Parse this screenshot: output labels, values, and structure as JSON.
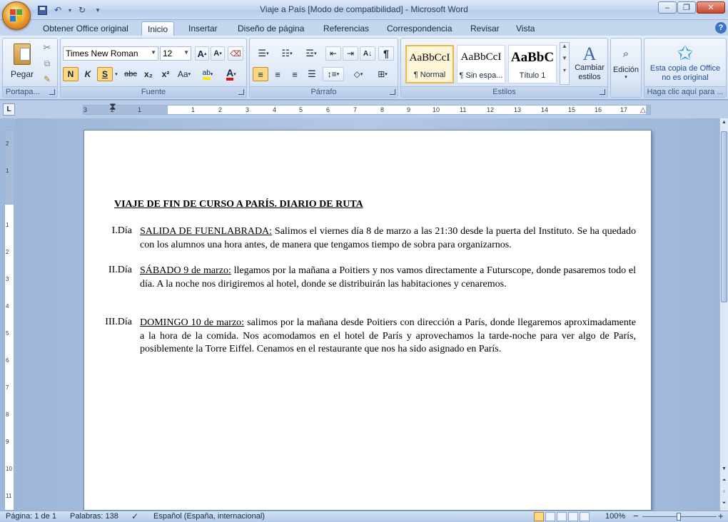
{
  "window": {
    "title": "Viaje a País [Modo de compatibilidad] - Microsoft Word",
    "minimize": "‒",
    "maximize": "❐",
    "close": "✕"
  },
  "tabs": [
    {
      "label": "Obtener Office original"
    },
    {
      "label": "Inicio"
    },
    {
      "label": "Insertar"
    },
    {
      "label": "Diseño de página"
    },
    {
      "label": "Referencias"
    },
    {
      "label": "Correspondencia"
    },
    {
      "label": "Revisar"
    },
    {
      "label": "Vista"
    }
  ],
  "ribbon": {
    "clipboard": {
      "label": "Portapa...",
      "paste": "Pegar"
    },
    "font": {
      "label": "Fuente",
      "font_name": "Times New Roman",
      "font_size": "12",
      "grow": "A",
      "shrink": "A",
      "bold": "N",
      "italic": "K",
      "underline": "S",
      "strike": "abc",
      "subscript": "x₂",
      "superscript": "x²",
      "case": "Aa",
      "highlight": "ab",
      "color": "A"
    },
    "paragraph": {
      "label": "Párrafo",
      "pilcrow": "¶",
      "sort": "A↓"
    },
    "styles": {
      "label": "Estilos",
      "items": [
        {
          "sample": "AaBbCcI",
          "name": "¶ Normal"
        },
        {
          "sample": "AaBbCcI",
          "name": "¶ Sin espa..."
        },
        {
          "sample": "AaBbC",
          "name": "Título 1"
        }
      ],
      "change_styles": "Cambiar estilos"
    },
    "editing": {
      "label": "Edición"
    },
    "office": {
      "line1": "Esta copia de Office",
      "line2": "no es original",
      "label": "Haga clic aquí para ..."
    }
  },
  "ruler": {
    "tab_selector": "L",
    "ticks": [
      "3",
      "2",
      "1",
      "1",
      "2",
      "3",
      "4",
      "5",
      "6",
      "7",
      "8",
      "9",
      "10",
      "11",
      "12",
      "13",
      "14",
      "15",
      "16",
      "17"
    ],
    "vticks": [
      "2",
      "1",
      "1",
      "2",
      "3",
      "4",
      "5",
      "6",
      "7",
      "8",
      "9",
      "10",
      "11"
    ]
  },
  "document": {
    "title": "VIAJE DE FIN DE CURSO A PARÍS. DIARIO DE RUTA",
    "entries": [
      {
        "num": "I.Día",
        "lead": "SALIDA DE FUENLABRADA:",
        "text": " Salimos el viernes día 8 de marzo a las 21:30 desde la puerta del Instituto. Se ha quedado con los alumnos una hora antes, de manera que tengamos tiempo de sobra para organizarnos."
      },
      {
        "num": "II.Día",
        "lead": "SÁBADO 9 de marzo:",
        "text": " llegamos por la mañana a Poitiers y nos vamos directamente a Futurscope, donde pasaremos todo el día. A la noche nos dirigiremos al hotel, donde se distribuirán las habitaciones y cenaremos."
      },
      {
        "num": "III.Día",
        "lead": "DOMINGO 10 de marzo:",
        "text": " salimos por la mañana desde Poitiers con dirección a París, donde llegaremos aproximadamente a la hora de la comida. Nos acomodamos en el hotel de París y aprovechamos la tarde-noche para ver algo de París, posiblemente la Torre Eiffel. Cenamos en el restaurante que nos ha sido asignado en París."
      }
    ]
  },
  "status": {
    "page": "Página: 1 de 1",
    "words": "Palabras: 138",
    "language": "Español (España, internacional)",
    "zoom": "100%",
    "minus": "−",
    "plus": "+"
  },
  "colors": {
    "accent": "#f2b54a",
    "ribbon": "#dbe6f5",
    "page": "#ffffff"
  }
}
